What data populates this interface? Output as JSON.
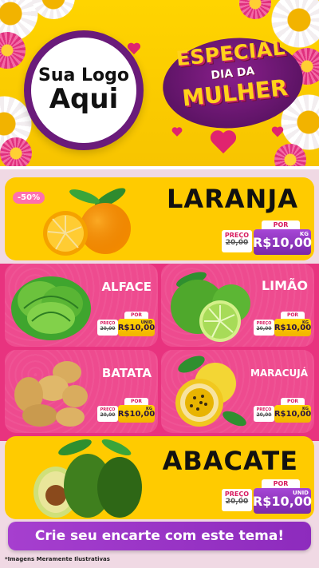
{
  "header": {
    "logo_line1": "Sua Logo",
    "logo_line2": "Aqui",
    "badge_line1": "ESPECIAL",
    "badge_line2": "DIA DA",
    "badge_line3": "MULHER"
  },
  "products": [
    {
      "name": "LARANJA",
      "discount": "-50%",
      "por_label": "POR",
      "preco_label": "PREÇO",
      "old_price": "20,00",
      "new_price": "R$10,00",
      "unit": "KG"
    },
    {
      "name": "ALFACE",
      "por_label": "POR",
      "preco_label": "PREÇO",
      "old_price": "20,00",
      "new_price": "R$10,00",
      "unit": "UNID"
    },
    {
      "name": "LIMÃO",
      "por_label": "POR",
      "preco_label": "PREÇO",
      "old_price": "20,00",
      "new_price": "R$10,00",
      "unit": "KG"
    },
    {
      "name": "BATATA",
      "por_label": "POR",
      "preco_label": "PREÇO",
      "old_price": "20,00",
      "new_price": "R$10,00",
      "unit": "KG"
    },
    {
      "name": "MARACUJÁ",
      "por_label": "POR",
      "preco_label": "PREÇO",
      "old_price": "20,00",
      "new_price": "R$10,00",
      "unit": "KG"
    },
    {
      "name": "ABACATE",
      "por_label": "POR",
      "preco_label": "PREÇO",
      "old_price": "20,00",
      "new_price": "R$10,00",
      "unit": "UNID"
    }
  ],
  "cta": {
    "label": "Crie seu encarte com este tema!"
  },
  "footer": {
    "note": "*Imagens Meramente Ilustrativas"
  },
  "colors": {
    "accent_purple": "#8d2bbd",
    "accent_pink": "#e8337f",
    "accent_yellow": "#ffcb00"
  }
}
